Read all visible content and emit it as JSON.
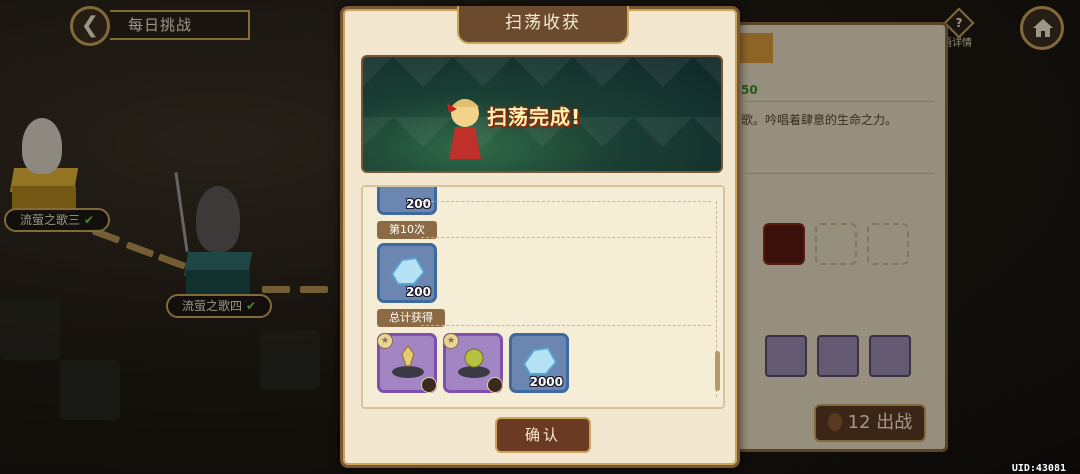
{
  "header": {
    "back_icon": "arrow-left-icon",
    "title": "每日挑战"
  },
  "home_icon": "home-icon",
  "help": {
    "icon": "question-icon",
    "label": "语详情"
  },
  "map": {
    "stage_3": {
      "label": "流萤之歌三",
      "completed": true
    },
    "stage_4": {
      "label": "流萤之歌四",
      "completed": true
    }
  },
  "back_panel": {
    "stat_fragment": "50",
    "desc_fragment": "歌。吟唱着肆意的生命之力。",
    "fight_label": "12 出战"
  },
  "modal": {
    "title": "扫荡收获",
    "banner_text": "扫荡完成!",
    "rewards": {
      "prev_qty": "200",
      "round_label": "第10次",
      "round_qty": "200",
      "total_label": "总计获得",
      "total_items": [
        {
          "name": "ornament-a",
          "rarity": "purple",
          "qty": ""
        },
        {
          "name": "ornament-b",
          "rarity": "purple",
          "qty": ""
        },
        {
          "name": "crystal",
          "rarity": "blue",
          "qty": "2000"
        }
      ]
    },
    "confirm": "确认"
  },
  "uid": "UID:43081",
  "colors": {
    "gold": "#c9a45a",
    "parchment": "#f3e8cf",
    "brown": "#6b4a2e"
  }
}
